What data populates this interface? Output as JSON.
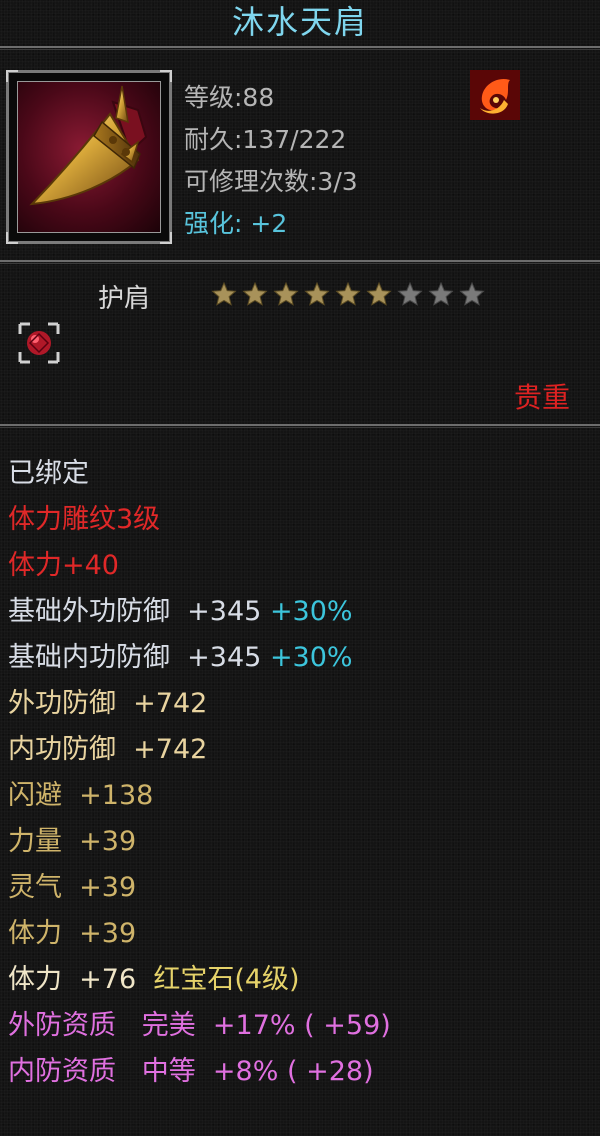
{
  "item": {
    "name": "沐水天肩",
    "level": "等级:88",
    "durability": "耐久:137/222",
    "repairs": "可修理次数:3/3",
    "enhance_label": "强化:",
    "enhance_value": "+2",
    "type": "护肩",
    "stars_filled": 6,
    "stars_total": 9,
    "rarity": "贵重",
    "icon": "golden-shoulder-pad-icon",
    "badge_icon": "fire-element-icon",
    "socket_icon": "ruby-gem-socket-icon"
  },
  "attributes": {
    "bound": "已绑定",
    "engrave": "体力雕纹3级",
    "engrave_bonus": "体力+40",
    "base_outer_label": "基础外功防御",
    "base_outer_value": "+345",
    "base_outer_pct": "+30%",
    "base_inner_label": "基础内功防御",
    "base_inner_value": "+345",
    "base_inner_pct": "+30%",
    "outer_label": "外功防御",
    "outer_value": "+742",
    "inner_label": "内功防御",
    "inner_value": "+742",
    "dodge_label": "闪避",
    "dodge_value": "+138",
    "str_label": "力量",
    "str_value": "+39",
    "spirit_label": "灵气",
    "spirit_value": "+39",
    "vit_label": "体力",
    "vit_value": "+39",
    "gem_stat_label": "体力",
    "gem_stat_value": "+76",
    "gem_name": "红宝石(4级)",
    "q1_label": "外防资质",
    "q1_grade": "完美",
    "q1_value": "+17%",
    "q1_extra": "( +59)",
    "q2_label": "内防资质",
    "q2_grade": "中等",
    "q2_value": "+8%",
    "q2_extra": "( +28)"
  },
  "colors": {
    "title": "#7fd6ee",
    "enhance": "#58c4dc",
    "engrave": "#e02828",
    "base_pct": "#3cc5dc",
    "defense": "#e9d4a0",
    "quality": "#e070e0",
    "rarity": "#dd2222",
    "star_filled": "#a8925a",
    "star_empty": "#7a7a7a"
  }
}
